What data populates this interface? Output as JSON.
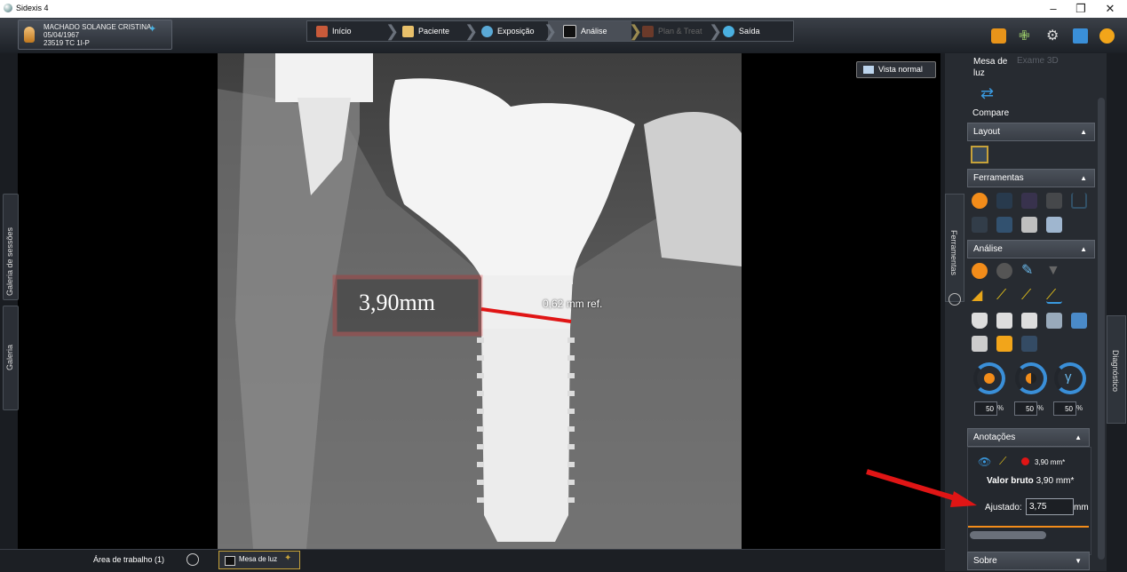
{
  "window": {
    "title": "Sidexis 4",
    "controls": [
      "minimize-icon",
      "restore-icon",
      "close-icon"
    ]
  },
  "patient": {
    "name": "MACHADO SOLANGE CRISTINA",
    "birthdate": "05/04/1967",
    "id": "23519 TC 1I-P"
  },
  "nav": {
    "tabs": [
      {
        "label": "Início",
        "icon": "home-icon"
      },
      {
        "label": "Paciente",
        "icon": "patient-icon"
      },
      {
        "label": "Exposição",
        "icon": "exposure-icon"
      },
      {
        "label": "Análise",
        "icon": "analysis-icon",
        "active": true
      },
      {
        "label": "Plan & Treat",
        "icon": "plan-icon",
        "disabled": true
      },
      {
        "label": "Saída",
        "icon": "output-icon"
      }
    ]
  },
  "viewer": {
    "vista_normal_label": "Vista normal",
    "measure_label": "3,90mm",
    "ref_label": "0,62 mm ref."
  },
  "left_tabs": {
    "sessions": "Galeria de sessões",
    "gallery": "Galeria"
  },
  "right_panel": {
    "mesa_luz": "Mesa de luz",
    "exame3d": "Exame 3D",
    "compare": "Compare",
    "layout": "Layout",
    "ferramentas": "Ferramentas",
    "analise": "Análise",
    "anotacoes": "Anotações",
    "sobre": "Sobre",
    "side_ferramentas": "Ferramentas",
    "side_diagnostico": "Diagnóstico",
    "percent": [
      "50",
      "50",
      "50"
    ],
    "percent_unit": "%",
    "annotation_value": "3,90 mm*",
    "valor_bruto_label": "Valor bruto",
    "valor_bruto_value": "3,90 mm*",
    "ajustado_label": "Ajustado:",
    "ajustado_value": "3,75",
    "ajustado_unit": "mm"
  },
  "bottom": {
    "workspace": "Área de trabalho (1)",
    "mesa_tab": "Mesa de luz"
  },
  "colors": {
    "accent_blue": "#3a8fd8",
    "highlight_red": "#e01515",
    "orange": "#f28c1a"
  }
}
